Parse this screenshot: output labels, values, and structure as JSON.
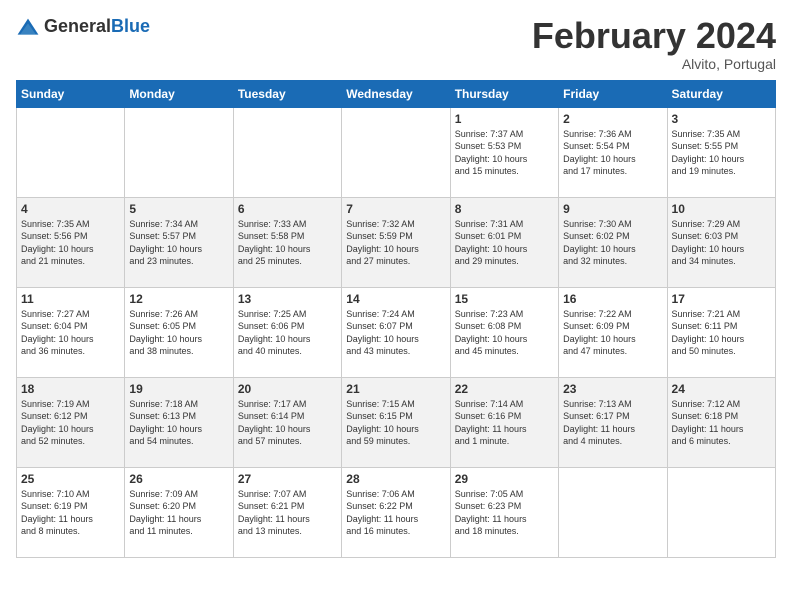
{
  "header": {
    "logo_general": "General",
    "logo_blue": "Blue",
    "title": "February 2024",
    "subtitle": "Alvito, Portugal"
  },
  "weekdays": [
    "Sunday",
    "Monday",
    "Tuesday",
    "Wednesday",
    "Thursday",
    "Friday",
    "Saturday"
  ],
  "weeks": [
    [
      {
        "day": "",
        "info": ""
      },
      {
        "day": "",
        "info": ""
      },
      {
        "day": "",
        "info": ""
      },
      {
        "day": "",
        "info": ""
      },
      {
        "day": "1",
        "info": "Sunrise: 7:37 AM\nSunset: 5:53 PM\nDaylight: 10 hours\nand 15 minutes."
      },
      {
        "day": "2",
        "info": "Sunrise: 7:36 AM\nSunset: 5:54 PM\nDaylight: 10 hours\nand 17 minutes."
      },
      {
        "day": "3",
        "info": "Sunrise: 7:35 AM\nSunset: 5:55 PM\nDaylight: 10 hours\nand 19 minutes."
      }
    ],
    [
      {
        "day": "4",
        "info": "Sunrise: 7:35 AM\nSunset: 5:56 PM\nDaylight: 10 hours\nand 21 minutes."
      },
      {
        "day": "5",
        "info": "Sunrise: 7:34 AM\nSunset: 5:57 PM\nDaylight: 10 hours\nand 23 minutes."
      },
      {
        "day": "6",
        "info": "Sunrise: 7:33 AM\nSunset: 5:58 PM\nDaylight: 10 hours\nand 25 minutes."
      },
      {
        "day": "7",
        "info": "Sunrise: 7:32 AM\nSunset: 5:59 PM\nDaylight: 10 hours\nand 27 minutes."
      },
      {
        "day": "8",
        "info": "Sunrise: 7:31 AM\nSunset: 6:01 PM\nDaylight: 10 hours\nand 29 minutes."
      },
      {
        "day": "9",
        "info": "Sunrise: 7:30 AM\nSunset: 6:02 PM\nDaylight: 10 hours\nand 32 minutes."
      },
      {
        "day": "10",
        "info": "Sunrise: 7:29 AM\nSunset: 6:03 PM\nDaylight: 10 hours\nand 34 minutes."
      }
    ],
    [
      {
        "day": "11",
        "info": "Sunrise: 7:27 AM\nSunset: 6:04 PM\nDaylight: 10 hours\nand 36 minutes."
      },
      {
        "day": "12",
        "info": "Sunrise: 7:26 AM\nSunset: 6:05 PM\nDaylight: 10 hours\nand 38 minutes."
      },
      {
        "day": "13",
        "info": "Sunrise: 7:25 AM\nSunset: 6:06 PM\nDaylight: 10 hours\nand 40 minutes."
      },
      {
        "day": "14",
        "info": "Sunrise: 7:24 AM\nSunset: 6:07 PM\nDaylight: 10 hours\nand 43 minutes."
      },
      {
        "day": "15",
        "info": "Sunrise: 7:23 AM\nSunset: 6:08 PM\nDaylight: 10 hours\nand 45 minutes."
      },
      {
        "day": "16",
        "info": "Sunrise: 7:22 AM\nSunset: 6:09 PM\nDaylight: 10 hours\nand 47 minutes."
      },
      {
        "day": "17",
        "info": "Sunrise: 7:21 AM\nSunset: 6:11 PM\nDaylight: 10 hours\nand 50 minutes."
      }
    ],
    [
      {
        "day": "18",
        "info": "Sunrise: 7:19 AM\nSunset: 6:12 PM\nDaylight: 10 hours\nand 52 minutes."
      },
      {
        "day": "19",
        "info": "Sunrise: 7:18 AM\nSunset: 6:13 PM\nDaylight: 10 hours\nand 54 minutes."
      },
      {
        "day": "20",
        "info": "Sunrise: 7:17 AM\nSunset: 6:14 PM\nDaylight: 10 hours\nand 57 minutes."
      },
      {
        "day": "21",
        "info": "Sunrise: 7:15 AM\nSunset: 6:15 PM\nDaylight: 10 hours\nand 59 minutes."
      },
      {
        "day": "22",
        "info": "Sunrise: 7:14 AM\nSunset: 6:16 PM\nDaylight: 11 hours\nand 1 minute."
      },
      {
        "day": "23",
        "info": "Sunrise: 7:13 AM\nSunset: 6:17 PM\nDaylight: 11 hours\nand 4 minutes."
      },
      {
        "day": "24",
        "info": "Sunrise: 7:12 AM\nSunset: 6:18 PM\nDaylight: 11 hours\nand 6 minutes."
      }
    ],
    [
      {
        "day": "25",
        "info": "Sunrise: 7:10 AM\nSunset: 6:19 PM\nDaylight: 11 hours\nand 8 minutes."
      },
      {
        "day": "26",
        "info": "Sunrise: 7:09 AM\nSunset: 6:20 PM\nDaylight: 11 hours\nand 11 minutes."
      },
      {
        "day": "27",
        "info": "Sunrise: 7:07 AM\nSunset: 6:21 PM\nDaylight: 11 hours\nand 13 minutes."
      },
      {
        "day": "28",
        "info": "Sunrise: 7:06 AM\nSunset: 6:22 PM\nDaylight: 11 hours\nand 16 minutes."
      },
      {
        "day": "29",
        "info": "Sunrise: 7:05 AM\nSunset: 6:23 PM\nDaylight: 11 hours\nand 18 minutes."
      },
      {
        "day": "",
        "info": ""
      },
      {
        "day": "",
        "info": ""
      }
    ]
  ]
}
